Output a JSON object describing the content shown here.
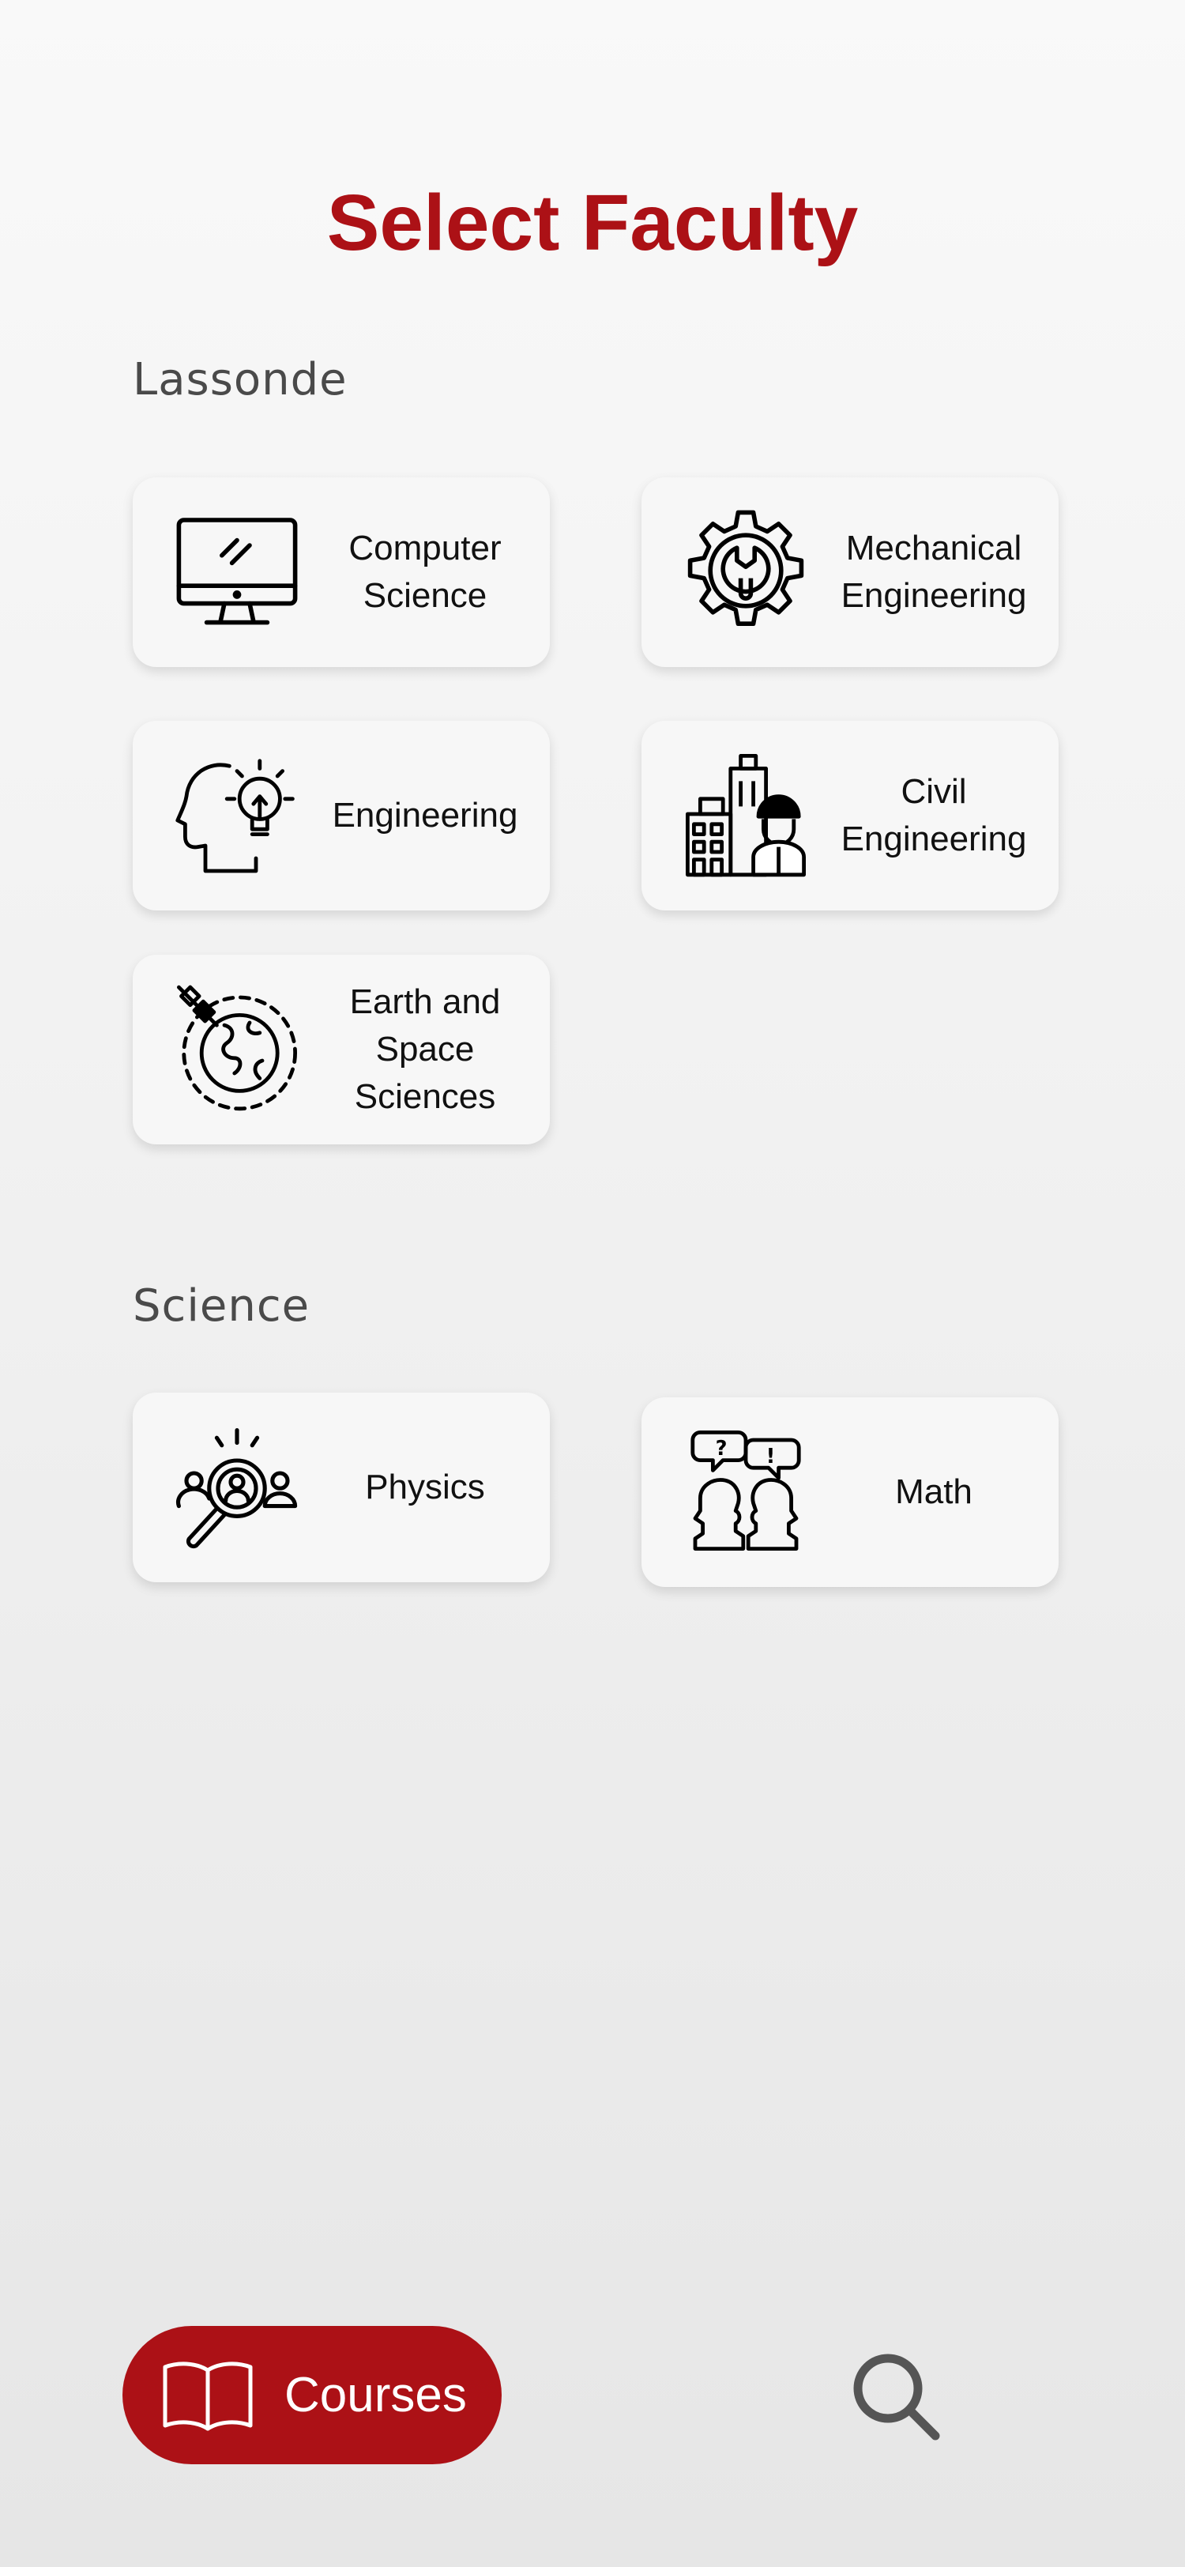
{
  "title": "Select Faculty",
  "sections": [
    {
      "label": "Lassonde",
      "faculties": [
        {
          "label": "Computer\nScience",
          "icon": "computer-monitor-icon"
        },
        {
          "label": "Mechanical\nEngineering",
          "icon": "gear-wrench-icon"
        },
        {
          "label": "Engineering",
          "icon": "head-lightbulb-icon"
        },
        {
          "label": "Civil\nEngineering",
          "icon": "building-worker-icon"
        },
        {
          "label": "Earth and\nSpace\nSciences",
          "icon": "globe-satellite-icon"
        }
      ]
    },
    {
      "label": "Science",
      "faculties": [
        {
          "label": "Physics",
          "icon": "magnifier-person-icon"
        },
        {
          "label": "Math",
          "icon": "people-discussion-icon"
        }
      ]
    }
  ],
  "bottom_nav": {
    "courses_label": "Courses",
    "courses_icon": "open-book-icon",
    "search_icon": "search-icon"
  },
  "colors": {
    "brand_red": "#ac1116",
    "card_bg": "#f7f7f7",
    "section_label": "#4a4a4a"
  }
}
